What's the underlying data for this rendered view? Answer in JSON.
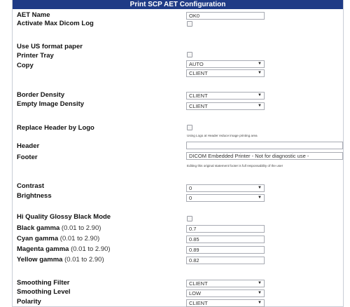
{
  "title": "Print SCP AET Configuration",
  "fields": {
    "aet_name": {
      "label": "AET Name",
      "value": "OK0"
    },
    "activate_max_dicom_log": {
      "label": "Activate Max Dicom Log"
    },
    "use_us_format_paper": {
      "label": "Use US format paper"
    },
    "printer_tray": {
      "label": "Printer Tray",
      "value": "AUTO"
    },
    "copy": {
      "label": "Copy",
      "value": "CLIENT"
    },
    "border_density": {
      "label": "Border Density",
      "value": "CLIENT"
    },
    "empty_image_density": {
      "label": "Empty Image Density",
      "value": "CLIENT"
    },
    "replace_header_by_logo": {
      "label": "Replace Header by Logo",
      "note": "Using Logo at Header reduce image printing area"
    },
    "header": {
      "label": "Header",
      "value": ""
    },
    "footer": {
      "label": "Footer",
      "value": "DICOM Embedded Printer - Not for diagnostic use -",
      "note": "Editing this original statement footer is full responsability of the user"
    },
    "contrast": {
      "label": "Contrast",
      "value": "0"
    },
    "brightness": {
      "label": "Brightness",
      "value": "0"
    },
    "hi_quality_glossy": {
      "label": "Hi Quality Glossy Black Mode"
    },
    "black_gamma": {
      "label": "Black gamma",
      "range": "(0.01 to 2.90)",
      "value": "0.7"
    },
    "cyan_gamma": {
      "label": "Cyan gamma",
      "range": "(0.01 to 2.90)",
      "value": "0.85"
    },
    "magenta_gamma": {
      "label": "Magenta gamma",
      "range": "(0.01 to 2.90)",
      "value": "0.89"
    },
    "yellow_gamma": {
      "label": "Yellow gamma",
      "range": "(0.01 to 2.90)",
      "value": "0.82"
    },
    "smoothing_filter": {
      "label": "Smoothing Filter",
      "value": "CLIENT"
    },
    "smoothing_level": {
      "label": "Smoothing Level",
      "value": "LOW"
    },
    "polarity": {
      "label": "Polarity",
      "value": "CLIENT"
    }
  },
  "icons": {
    "dropdown": "chevron-down-icon"
  },
  "colors": {
    "title_bar": "#1f3b86",
    "title_text": "#ffffff",
    "border": "#c9cdd6"
  }
}
